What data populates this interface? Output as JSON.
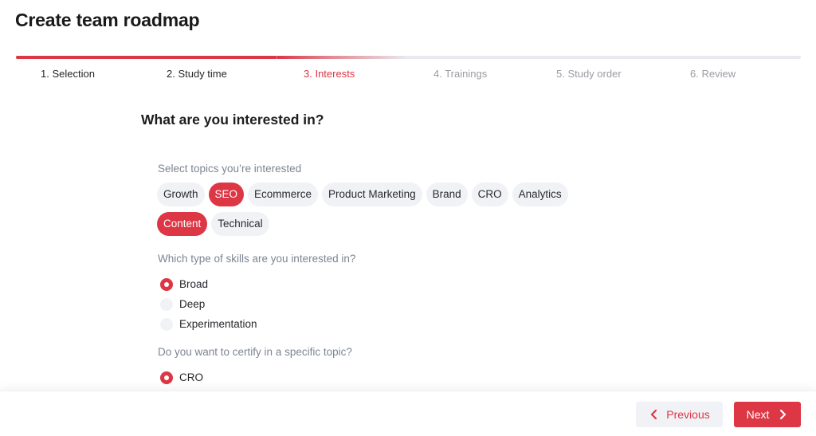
{
  "header": {
    "title": "Create team roadmap"
  },
  "stepper": {
    "current_step": 3,
    "total_steps": 6,
    "steps": [
      {
        "label": "1. Selection",
        "state": "done"
      },
      {
        "label": "2. Study time",
        "state": "done"
      },
      {
        "label": "3. Interests",
        "state": "active"
      },
      {
        "label": "4. Trainings",
        "state": "upcoming"
      },
      {
        "label": "5. Study order",
        "state": "upcoming"
      },
      {
        "label": "6. Review",
        "state": "upcoming"
      }
    ]
  },
  "main": {
    "title": "What are you interested in?",
    "topics": {
      "label": "Select topics you’re interested",
      "chips": [
        {
          "label": "Growth",
          "selected": false
        },
        {
          "label": "SEO",
          "selected": true
        },
        {
          "label": "Ecommerce",
          "selected": false
        },
        {
          "label": "Product Marketing",
          "selected": false
        },
        {
          "label": "Brand",
          "selected": false
        },
        {
          "label": "CRO",
          "selected": false
        },
        {
          "label": "Analytics",
          "selected": false
        },
        {
          "label": "Content",
          "selected": true
        },
        {
          "label": "Technical",
          "selected": false
        }
      ]
    },
    "skills": {
      "label": "Which type of skills are you interested in?",
      "options": [
        {
          "label": "Broad",
          "checked": true
        },
        {
          "label": "Deep",
          "checked": false
        },
        {
          "label": "Experimentation",
          "checked": false
        }
      ]
    },
    "certify": {
      "label": "Do you want to certify in a specific topic?",
      "options": [
        {
          "label": "CRO",
          "checked": true
        }
      ]
    }
  },
  "footer": {
    "previous_label": "Previous",
    "next_label": "Next"
  },
  "colors": {
    "accent": "#dd3645",
    "chip_bg": "#f1f2f5",
    "muted_text": "#7d8592"
  }
}
